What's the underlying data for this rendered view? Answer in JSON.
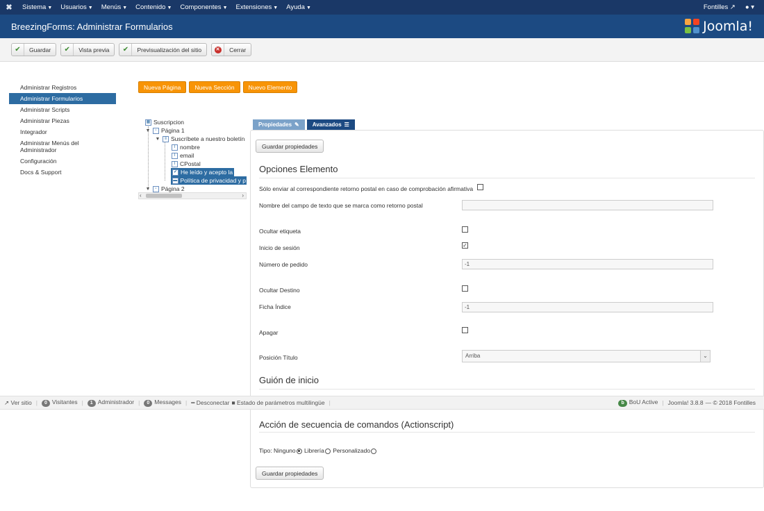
{
  "topbar": {
    "menu": [
      "Sistema",
      "Usuarios",
      "Menús",
      "Contenido",
      "Componentes",
      "Extensiones",
      "Ayuda"
    ],
    "site_link": "Fontilles",
    "user_icon": "user-icon"
  },
  "header": {
    "title": "BreezingForms: Administrar Formularios",
    "logo_text": "Joomla!"
  },
  "toolbar": {
    "save": "Guardar",
    "preview": "Vista previa",
    "site_preview": "Previsualización del sitio",
    "close": "Cerrar"
  },
  "sidebar": {
    "items": [
      {
        "label": "Administrar Registros"
      },
      {
        "label": "Administrar Formularios"
      },
      {
        "label": "Administrar Scripts"
      },
      {
        "label": "Administrar Piezas"
      },
      {
        "label": "Integrador"
      },
      {
        "label": "Administrar Menús del Administrador"
      },
      {
        "label": "Configuración"
      },
      {
        "label": "Docs & Support"
      }
    ]
  },
  "actions": {
    "new_page": "Nueva Página",
    "new_section": "Nueva Sección",
    "new_element": "Nuevo Elemento"
  },
  "tree": {
    "root": "Suscripcion",
    "page1": "Página 1",
    "section": "Suscríbete a nuestro boletín",
    "fields": [
      "nombre",
      "email",
      "CPostal"
    ],
    "selected1": "He leído y acepto la",
    "selected2": "Política de privacidad y p",
    "page2": "Página 2"
  },
  "tabs": {
    "properties": "Propiedades",
    "advanced": "Avanzados"
  },
  "panel": {
    "save_props": "Guardar propiedades",
    "options_heading": "Opciones Elemento",
    "only_send_label": "Sólo enviar al correspondiente retorno postal en caso de comprobación afirmativa",
    "field_name_label": "Nombre del campo de texto que se marca como retorno postal",
    "hide_label_label": "Ocultar etiqueta",
    "login_label": "Inicio de sesión",
    "order_label": "Número de pedido",
    "order_value": "-1",
    "hide_target_label": "Ocultar Destino",
    "tab_index_label": "Ficha Índice",
    "tab_index_value": "-1",
    "off_label": "Apagar",
    "title_pos_label": "Posición Título",
    "title_pos_value": "Arriba",
    "init_script_heading": "Guión de inicio",
    "action_script_heading": "Acción de secuencia de comandos (Actionscript)",
    "type_label": "Tipo:",
    "type_none": "Ninguno",
    "type_library": "Librería",
    "type_custom": "Personalizado",
    "login_checked": true
  },
  "status": {
    "view_site": "Ver sitio",
    "visitors_count": "0",
    "visitors": "Visitantes",
    "admin_count": "1",
    "admin": "Administrador",
    "messages_count": "0",
    "messages": "Messages",
    "logout": "Desconectar",
    "multilang": "Estado de parámetros multilingüe",
    "bou": "BoU Active",
    "version": "Joomla! 3.8.8",
    "copyright": "— © 2018 Fontilles"
  }
}
